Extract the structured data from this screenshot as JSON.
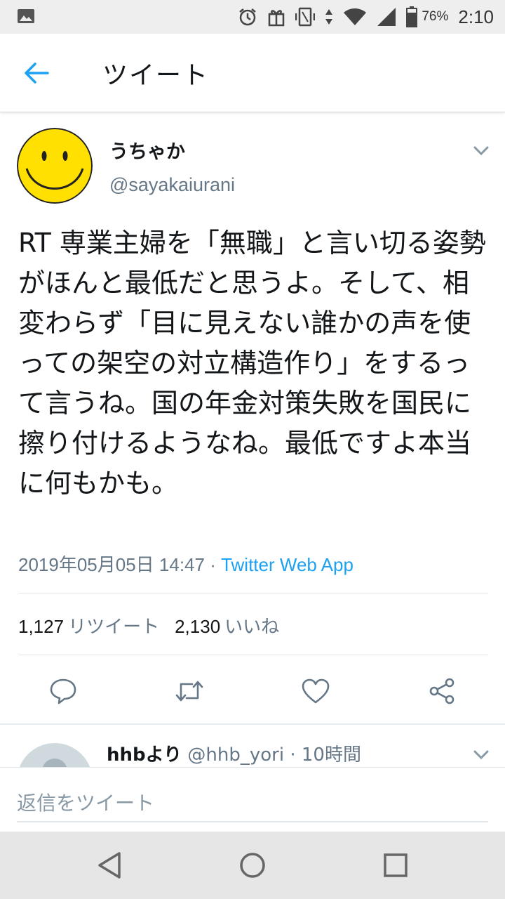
{
  "status_bar": {
    "battery_percent": "76%",
    "time": "2:10",
    "icons": [
      "image-icon",
      "alarm-icon",
      "gift-icon",
      "vibrate-icon",
      "data-arrows-icon",
      "wifi-icon",
      "signal-icon",
      "battery-icon"
    ]
  },
  "header": {
    "title": "ツイート",
    "back_icon": "arrow-left-icon"
  },
  "tweet": {
    "display_name": "うちゃか",
    "handle": "@sayakaiurani",
    "text": "RT 専業主婦を「無職」と言い切る姿勢がほんと最低だと思うよ。そして、相変わらず「目に見えない誰かの声を使っての架空の対立構造作り」をするって言うね。国の年金対策失敗を国民に擦り付けるようなね。最低ですよ本当に何もかも。",
    "timestamp": "2019年05月05日 14:47",
    "separator": " · ",
    "source_app": "Twitter Web App",
    "retweet_count": "1,127",
    "retweet_label": "リツイート",
    "like_count": "2,130",
    "like_label": "いいね",
    "actions": [
      "reply-icon",
      "retweet-icon",
      "like-icon",
      "share-icon"
    ]
  },
  "reply": {
    "name": "hhbより",
    "handle": "@hhb_yori",
    "time": "· 10時間"
  },
  "composer": {
    "placeholder": "返信をツイート"
  },
  "colors": {
    "accent": "#1da1f2",
    "text": "#14171a",
    "muted": "#657786",
    "avatar_yellow": "#ffe000"
  }
}
